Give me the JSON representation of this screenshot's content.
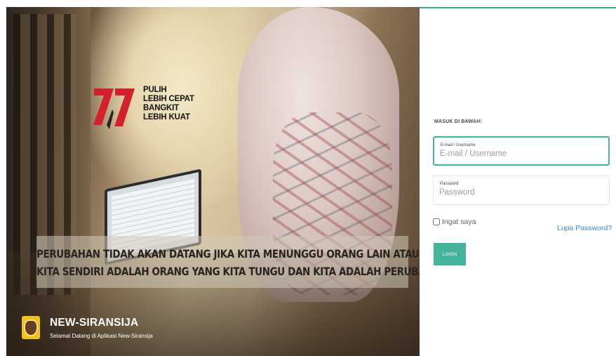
{
  "hero": {
    "tagline": [
      "PULIH",
      "LEBIH CEPAT",
      "BANGKIT",
      "LEBIH KUAT"
    ],
    "quote": [
      "PERUBAHAN TIDAK AKAN DATANG JIKA KITA MENUNGGU ORANG LAIN ATAU LAIN WAKTU.",
      "KITA SENDIRI ADALAH ORANG YANG KITA TUNGU DAN KITA ADALAH PERUBAHAN YANG KITA CARI."
    ],
    "brand_title": "NEW-SIRANSIJA",
    "brand_subtitle": "Selamat Datang di Aplikasi New-Siransija"
  },
  "login": {
    "heading": "MASUK DI BAWAH:",
    "email_label": "E-mail / Username",
    "email_placeholder": "E-mail / Username",
    "password_label": "Password",
    "password_placeholder": "Password",
    "remember_label": "Ingat saya",
    "forgot_label": "Lupa Password?",
    "login_label": "LOGIN"
  },
  "colors": {
    "accent": "#45b39c",
    "link": "#3b8ec7",
    "logo_red": "#d4202a"
  }
}
